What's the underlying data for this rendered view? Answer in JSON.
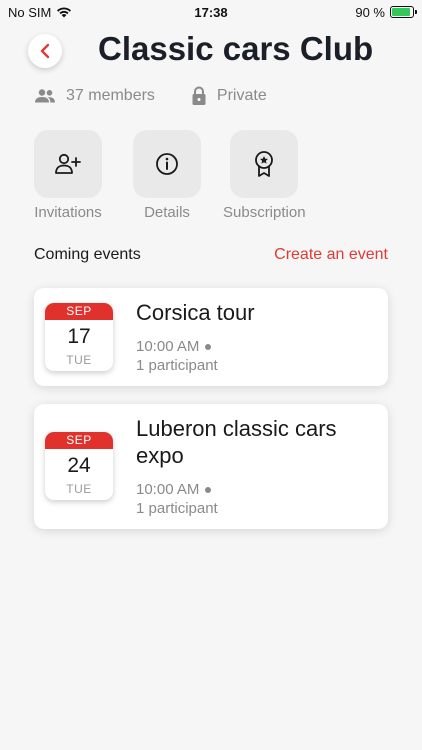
{
  "status_bar": {
    "carrier": "No SIM",
    "time": "17:38",
    "battery_text": "90 %",
    "battery_level": 0.9
  },
  "header": {
    "title": "Classic cars Club",
    "back_icon": "chevron-left-icon"
  },
  "meta": {
    "members": "37 members",
    "privacy": "Private"
  },
  "actions": [
    {
      "label": "Invitations",
      "icon": "add-user-icon"
    },
    {
      "label": "Details",
      "icon": "info-icon"
    },
    {
      "label": "Subscription",
      "icon": "badge-icon"
    }
  ],
  "events_section": {
    "title": "Coming events",
    "create_label": "Create an event"
  },
  "events": [
    {
      "month": "SEP",
      "day": "17",
      "weekday": "TUE",
      "title": "Corsica tour",
      "time": "10:00 AM",
      "participants": "1 participant"
    },
    {
      "month": "SEP",
      "day": "24",
      "weekday": "TUE",
      "title": "Luberon classic cars expo",
      "time": "10:00 AM",
      "participants": "1 participant"
    }
  ],
  "colors": {
    "accent": "#e03a35",
    "calendar_red": "#e0312c",
    "battery_green": "#34c759",
    "muted_text": "#8a8a8a",
    "tile_bg": "#e9e9e9"
  }
}
